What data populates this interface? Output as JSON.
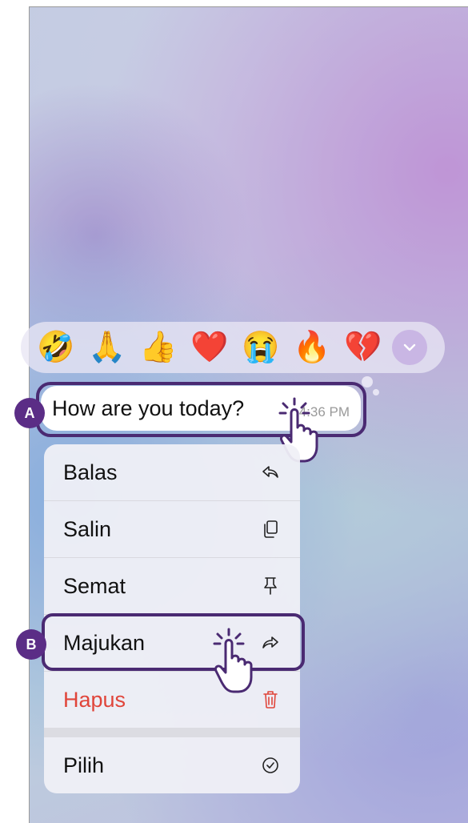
{
  "reactions": {
    "emojis": [
      {
        "glyph": "🤣",
        "name": "rolling-laughing-emoji"
      },
      {
        "glyph": "🙏",
        "name": "folded-hands-emoji"
      },
      {
        "glyph": "👍",
        "name": "thumbs-up-emoji"
      },
      {
        "glyph": "❤️",
        "name": "red-heart-emoji"
      },
      {
        "glyph": "😭",
        "name": "crying-face-emoji"
      },
      {
        "glyph": "🔥",
        "name": "fire-emoji"
      },
      {
        "glyph": "💔",
        "name": "broken-heart-emoji"
      }
    ],
    "more_icon": "chevron-down-icon"
  },
  "message": {
    "text": "How are you today?",
    "time": "4:36 PM"
  },
  "menu": {
    "items": [
      {
        "label": "Balas",
        "icon": "reply-icon"
      },
      {
        "label": "Salin",
        "icon": "copy-icon"
      },
      {
        "label": "Semat",
        "icon": "pin-icon"
      },
      {
        "label": "Majukan",
        "icon": "forward-icon"
      },
      {
        "label": "Hapus",
        "icon": "trash-icon"
      },
      {
        "label": "Pilih",
        "icon": "check-circle-icon"
      }
    ]
  },
  "annotations": {
    "a": "A",
    "b": "B"
  },
  "colors": {
    "annotation_purple": "#4a2a72",
    "badge_purple": "#5b2d86",
    "danger_red": "#e0453a",
    "more_button": "#c9b6e4"
  }
}
